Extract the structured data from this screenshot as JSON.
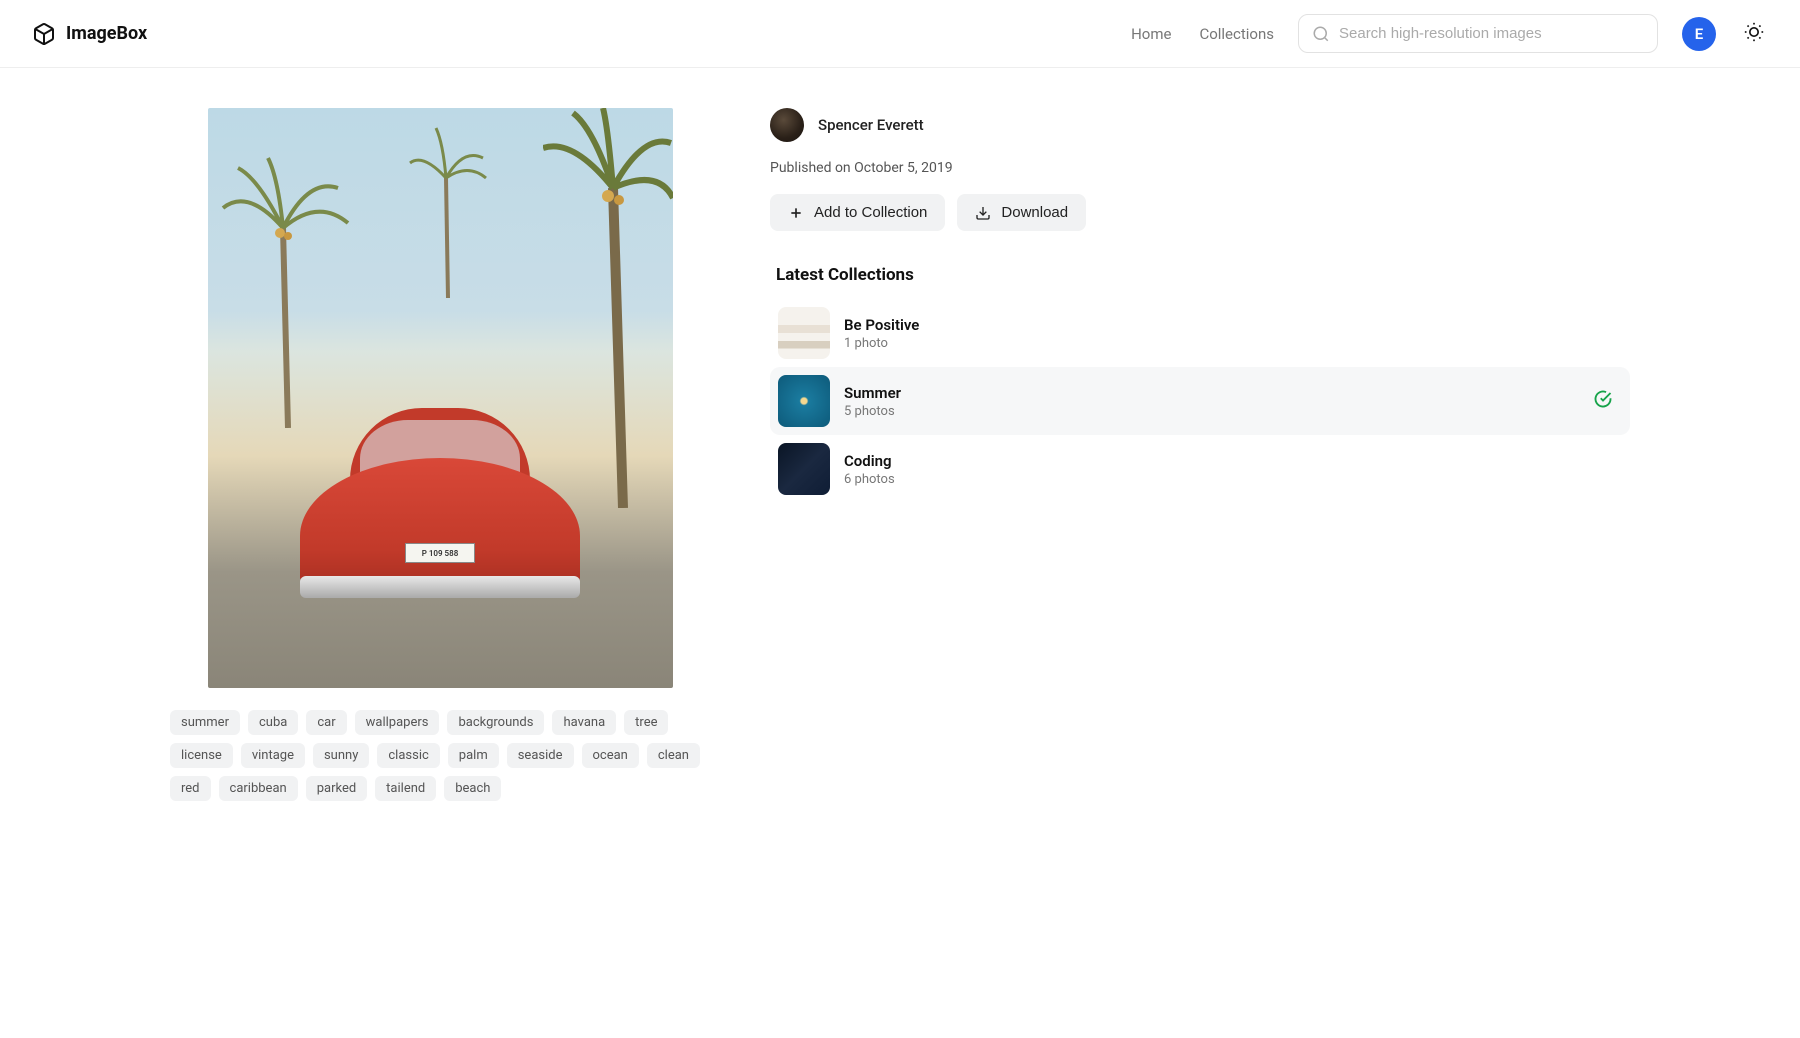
{
  "brand": "ImageBox",
  "nav": {
    "home": "Home",
    "collections": "Collections"
  },
  "search": {
    "placeholder": "Search high-resolution images"
  },
  "user": {
    "initial": "E"
  },
  "author": {
    "name": "Spencer Everett"
  },
  "published": "Published on October 5, 2019",
  "plate": "P 109 588",
  "actions": {
    "add": "Add to Collection",
    "download": "Download"
  },
  "latest_title": "Latest Collections",
  "collections": [
    {
      "name": "Be Positive",
      "count": "1 photo",
      "selected": false
    },
    {
      "name": "Summer",
      "count": "5 photos",
      "selected": true
    },
    {
      "name": "Coding",
      "count": "6 photos",
      "selected": false
    }
  ],
  "tags": [
    "summer",
    "cuba",
    "car",
    "wallpapers",
    "backgrounds",
    "havana",
    "tree",
    "license",
    "vintage",
    "sunny",
    "classic",
    "palm",
    "seaside",
    "ocean",
    "clean",
    "red",
    "caribbean",
    "parked",
    "tailend",
    "beach"
  ]
}
